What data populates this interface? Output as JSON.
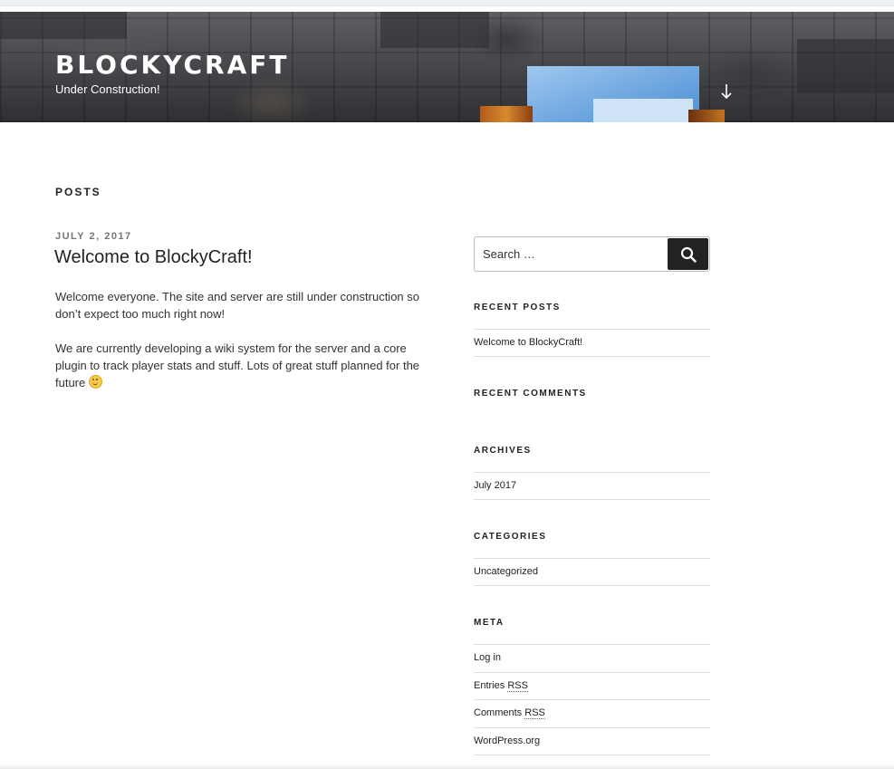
{
  "header": {
    "site_title": "BlockyCraft",
    "site_description": "Under Construction!",
    "scroll_icon": "arrow-down-icon"
  },
  "main": {
    "page_heading": "Posts",
    "post": {
      "date": "July 2, 2017",
      "title": "Welcome to BlockyCraft!",
      "paragraphs": [
        "Welcome everyone. The site and server are still under construction so don’t expect too much right now!",
        "We are currently developing a wiki system for the server and a core plugin to track player stats and stuff. Lots of great stuff planned for the future"
      ],
      "emoji_icon": "smiley-icon"
    }
  },
  "sidebar": {
    "search": {
      "placeholder": "Search …",
      "button_label": "Search",
      "icon": "search-icon"
    },
    "recent_posts": {
      "title": "Recent Posts",
      "items": [
        "Welcome to BlockyCraft!"
      ]
    },
    "recent_comments": {
      "title": "Recent Comments"
    },
    "archives": {
      "title": "Archives",
      "items": [
        "July 2017"
      ]
    },
    "categories": {
      "title": "Categories",
      "items": [
        "Uncategorized"
      ]
    },
    "meta": {
      "title": "Meta",
      "log_in": "Log in",
      "entries_label": "Entries",
      "comments_label": "Comments",
      "rss_abbr": "RSS",
      "wordpress": "WordPress.org"
    }
  }
}
